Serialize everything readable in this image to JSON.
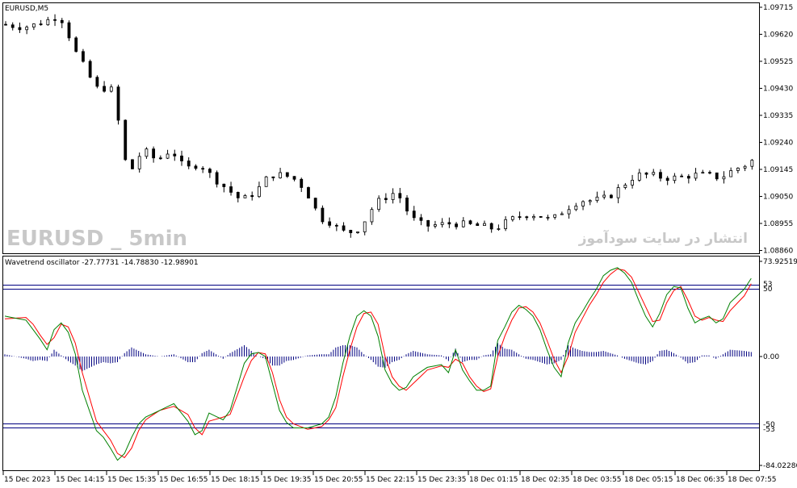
{
  "symbol_label": "EURUSD,M5",
  "watermark_left": "EURUSD _ 5min",
  "watermark_right": "انتشار در سایت سودآموز",
  "indicator_label": "Wavetrend oscillator -27.77731 -14.78830 -12.98901",
  "colors": {
    "background": "#ffffff",
    "frame": "#000000",
    "candle": "#000000",
    "wt1": "#008000",
    "wt2": "#ff0000",
    "histogram": "#000080",
    "level_lines": "#000080",
    "watermark": "#c8c8c8"
  },
  "price_axis": [
    "1.09715",
    "1.09620",
    "1.09525",
    "1.09430",
    "1.09335",
    "1.09240",
    "1.09145",
    "1.09050",
    "1.08955",
    "1.08860"
  ],
  "osc_axis": {
    "max": "73.92519",
    "level_53": "53",
    "level_50": "50",
    "zero": "0.00",
    "level_m50": "-50",
    "level_m53": "-53",
    "min": "-84.02286"
  },
  "time_axis": [
    "15 Dec 2023",
    "15 Dec 14:15",
    "15 Dec 15:35",
    "15 Dec 16:55",
    "15 Dec 18:15",
    "15 Dec 19:35",
    "15 Dec 20:55",
    "15 Dec 22:15",
    "15 Dec 23:35",
    "18 Dec 01:15",
    "18 Dec 02:35",
    "18 Dec 03:55",
    "18 Dec 05:15",
    "18 Dec 06:35",
    "18 Dec 07:55"
  ],
  "chart_data": {
    "type": "line",
    "title": "EURUSD,M5",
    "price_range": [
      1.0886,
      1.0972
    ],
    "price_path": [
      [
        0,
        1.0966
      ],
      [
        3,
        1.0965
      ],
      [
        5,
        1.0966
      ],
      [
        8,
        1.0969
      ],
      [
        9,
        1.0966
      ],
      [
        10,
        1.0958
      ],
      [
        11,
        1.0954
      ],
      [
        13,
        1.0945
      ],
      [
        14,
        1.0942
      ],
      [
        15,
        1.0945
      ],
      [
        16,
        1.0941
      ],
      [
        17,
        1.0923
      ],
      [
        18,
        1.0913
      ],
      [
        20,
        1.0922
      ],
      [
        22,
        1.0918
      ],
      [
        24,
        1.0922
      ],
      [
        26,
        1.0915
      ],
      [
        28,
        1.0917
      ],
      [
        30,
        1.0912
      ],
      [
        32,
        1.0908
      ],
      [
        34,
        1.0904
      ],
      [
        36,
        1.0907
      ],
      [
        38,
        1.0913
      ],
      [
        40,
        1.0913
      ],
      [
        42,
        1.0911
      ],
      [
        44,
        1.0904
      ],
      [
        45,
        1.0898
      ],
      [
        47,
        1.0896
      ],
      [
        48,
        1.0893
      ],
      [
        50,
        1.0893
      ],
      [
        51,
        1.0895
      ],
      [
        52,
        1.0899
      ],
      [
        53,
        1.0903
      ],
      [
        55,
        1.0906
      ],
      [
        56,
        1.0907
      ],
      [
        57,
        1.0903
      ],
      [
        58,
        1.0898
      ],
      [
        60,
        1.0895
      ],
      [
        64,
        1.0896
      ],
      [
        68,
        1.0895
      ],
      [
        70,
        1.0894
      ],
      [
        72,
        1.0897
      ],
      [
        74,
        1.0899
      ],
      [
        76,
        1.0899
      ],
      [
        78,
        1.0897
      ],
      [
        80,
        1.0901
      ],
      [
        82,
        1.0904
      ],
      [
        84,
        1.0904
      ],
      [
        86,
        1.0905
      ],
      [
        88,
        1.0909
      ],
      [
        90,
        1.0913
      ],
      [
        92,
        1.0913
      ],
      [
        94,
        1.0912
      ],
      [
        96,
        1.0912
      ],
      [
        98,
        1.0913
      ],
      [
        100,
        1.0913
      ],
      [
        102,
        1.0912
      ],
      [
        104,
        1.0915
      ],
      [
        106,
        1.0917
      ],
      [
        107,
        1.0919
      ]
    ],
    "wt_range": [
      -84.02286,
      73.92519
    ],
    "wt1": [
      [
        0,
        30
      ],
      [
        3,
        27
      ],
      [
        4,
        20
      ],
      [
        5,
        13
      ],
      [
        6,
        5
      ],
      [
        7,
        20
      ],
      [
        8,
        25
      ],
      [
        9,
        18
      ],
      [
        10,
        2
      ],
      [
        11,
        -25
      ],
      [
        12,
        -40
      ],
      [
        13,
        -55
      ],
      [
        14,
        -60
      ],
      [
        15,
        -68
      ],
      [
        16,
        -77
      ],
      [
        17,
        -72
      ],
      [
        18,
        -60
      ],
      [
        19,
        -50
      ],
      [
        20,
        -45
      ],
      [
        22,
        -40
      ],
      [
        24,
        -35
      ],
      [
        26,
        -48
      ],
      [
        27,
        -58
      ],
      [
        28,
        -55
      ],
      [
        29,
        -42
      ],
      [
        31,
        -47
      ],
      [
        32,
        -40
      ],
      [
        34,
        -5
      ],
      [
        35,
        2
      ],
      [
        36,
        3
      ],
      [
        37,
        0
      ],
      [
        38,
        -20
      ],
      [
        39,
        -40
      ],
      [
        40,
        -49
      ],
      [
        41,
        -53
      ],
      [
        43,
        -53
      ],
      [
        45,
        -50
      ],
      [
        46,
        -45
      ],
      [
        47,
        -30
      ],
      [
        48,
        -5
      ],
      [
        49,
        15
      ],
      [
        50,
        30
      ],
      [
        51,
        34
      ],
      [
        52,
        30
      ],
      [
        53,
        15
      ],
      [
        54,
        -10
      ],
      [
        55,
        -20
      ],
      [
        56,
        -25
      ],
      [
        57,
        -23
      ],
      [
        58,
        -15
      ],
      [
        60,
        -8
      ],
      [
        62,
        -6
      ],
      [
        63,
        -12
      ],
      [
        64,
        5
      ],
      [
        65,
        -10
      ],
      [
        66,
        -18
      ],
      [
        67,
        -25
      ],
      [
        68,
        -25
      ],
      [
        69,
        -22
      ],
      [
        70,
        12
      ],
      [
        71,
        22
      ],
      [
        72,
        33
      ],
      [
        73,
        38
      ],
      [
        74,
        35
      ],
      [
        75,
        30
      ],
      [
        76,
        20
      ],
      [
        77,
        5
      ],
      [
        78,
        -8
      ],
      [
        79,
        -15
      ],
      [
        80,
        10
      ],
      [
        81,
        25
      ],
      [
        82,
        33
      ],
      [
        83,
        42
      ],
      [
        84,
        50
      ],
      [
        85,
        60
      ],
      [
        86,
        64
      ],
      [
        87,
        66
      ],
      [
        88,
        62
      ],
      [
        89,
        55
      ],
      [
        90,
        42
      ],
      [
        91,
        30
      ],
      [
        92,
        22
      ],
      [
        93,
        32
      ],
      [
        94,
        46
      ],
      [
        95,
        52
      ],
      [
        96,
        51
      ],
      [
        97,
        36
      ],
      [
        98,
        25
      ],
      [
        99,
        28
      ],
      [
        100,
        30
      ],
      [
        101,
        25
      ],
      [
        102,
        28
      ],
      [
        103,
        40
      ],
      [
        105,
        50
      ],
      [
        106,
        58
      ]
    ],
    "wt2": [
      [
        0,
        28
      ],
      [
        3,
        29
      ],
      [
        4,
        24
      ],
      [
        5,
        16
      ],
      [
        6,
        9
      ],
      [
        7,
        14
      ],
      [
        8,
        24
      ],
      [
        9,
        22
      ],
      [
        10,
        10
      ],
      [
        11,
        -12
      ],
      [
        12,
        -30
      ],
      [
        13,
        -48
      ],
      [
        14,
        -55
      ],
      [
        15,
        -62
      ],
      [
        16,
        -72
      ],
      [
        17,
        -75
      ],
      [
        18,
        -68
      ],
      [
        19,
        -55
      ],
      [
        20,
        -47
      ],
      [
        22,
        -40
      ],
      [
        24,
        -37
      ],
      [
        26,
        -43
      ],
      [
        27,
        -53
      ],
      [
        28,
        -58
      ],
      [
        29,
        -48
      ],
      [
        31,
        -45
      ],
      [
        32,
        -43
      ],
      [
        34,
        -15
      ],
      [
        35,
        -3
      ],
      [
        36,
        3
      ],
      [
        37,
        2
      ],
      [
        38,
        -12
      ],
      [
        39,
        -32
      ],
      [
        40,
        -45
      ],
      [
        41,
        -50
      ],
      [
        43,
        -54
      ],
      [
        45,
        -52
      ],
      [
        46,
        -47
      ],
      [
        47,
        -38
      ],
      [
        48,
        -15
      ],
      [
        49,
        5
      ],
      [
        50,
        22
      ],
      [
        51,
        32
      ],
      [
        52,
        33
      ],
      [
        53,
        24
      ],
      [
        54,
        0
      ],
      [
        55,
        -15
      ],
      [
        56,
        -22
      ],
      [
        57,
        -25
      ],
      [
        58,
        -20
      ],
      [
        60,
        -10
      ],
      [
        62,
        -7
      ],
      [
        63,
        -8
      ],
      [
        64,
        -2
      ],
      [
        65,
        -5
      ],
      [
        66,
        -15
      ],
      [
        67,
        -22
      ],
      [
        68,
        -26
      ],
      [
        69,
        -24
      ],
      [
        70,
        0
      ],
      [
        71,
        15
      ],
      [
        72,
        27
      ],
      [
        73,
        36
      ],
      [
        74,
        37
      ],
      [
        75,
        33
      ],
      [
        76,
        25
      ],
      [
        77,
        12
      ],
      [
        78,
        -2
      ],
      [
        79,
        -12
      ],
      [
        80,
        0
      ],
      [
        81,
        18
      ],
      [
        82,
        28
      ],
      [
        83,
        38
      ],
      [
        84,
        46
      ],
      [
        85,
        55
      ],
      [
        86,
        61
      ],
      [
        87,
        65
      ],
      [
        88,
        64
      ],
      [
        89,
        59
      ],
      [
        90,
        48
      ],
      [
        91,
        37
      ],
      [
        92,
        26
      ],
      [
        93,
        27
      ],
      [
        94,
        40
      ],
      [
        95,
        49
      ],
      [
        96,
        52
      ],
      [
        97,
        42
      ],
      [
        98,
        30
      ],
      [
        99,
        27
      ],
      [
        100,
        29
      ],
      [
        101,
        27
      ],
      [
        102,
        26
      ],
      [
        103,
        34
      ],
      [
        105,
        45
      ],
      [
        106,
        54
      ]
    ],
    "levels": [
      53,
      50,
      -50,
      -53
    ],
    "grid": false,
    "legend": "none"
  }
}
